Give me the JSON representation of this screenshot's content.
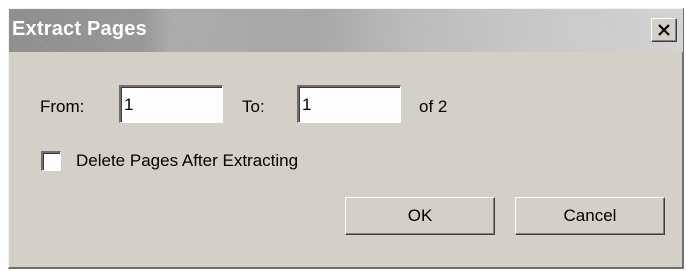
{
  "dialog": {
    "title": "Extract Pages",
    "close_icon": "close-icon"
  },
  "range": {
    "from_label": "From:",
    "from_value": "1",
    "to_label": "To:",
    "to_value": "1",
    "of_text": "of 2"
  },
  "options": {
    "delete_label": "Delete Pages After Extracting",
    "delete_checked": false
  },
  "buttons": {
    "ok_label": "OK",
    "cancel_label": "Cancel"
  }
}
